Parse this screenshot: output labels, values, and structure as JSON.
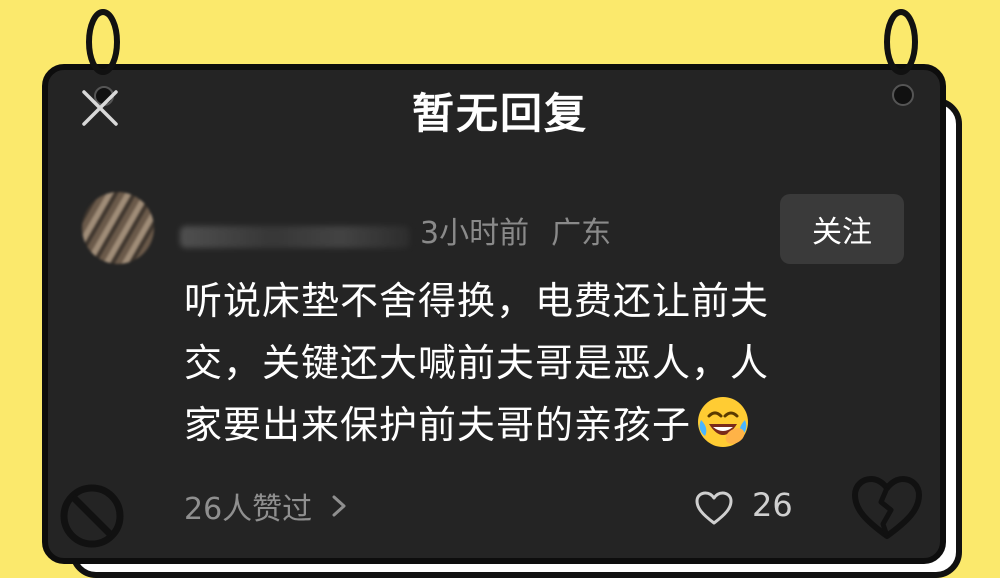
{
  "header": {
    "title": "暂无回复"
  },
  "comment": {
    "time": "3小时前",
    "location": "广东",
    "follow_label": "关注",
    "lines": [
      "听说床垫不舍得换，电费还让前夫",
      "交，关键还大喊前夫哥是恶人，人",
      "家要出来保护前夫哥的亲孩子"
    ],
    "emoji": "laughing-crying-emoji",
    "likers_text": "26人赞过",
    "like_count": "26"
  },
  "colors": {
    "background": "#fbe96c",
    "card": "#242424",
    "text": "#ffffff",
    "muted": "#8a8a8a"
  },
  "icons": [
    "close-icon",
    "heart-outline-icon",
    "chevron-right-icon",
    "ban-icon",
    "broken-heart-icon",
    "binder-ring-icon"
  ]
}
